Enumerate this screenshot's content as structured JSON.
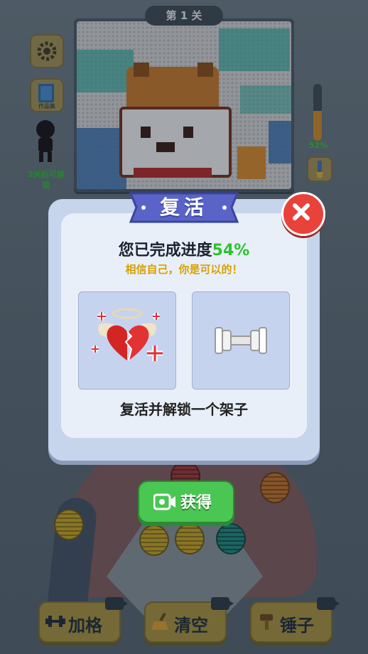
{
  "level": {
    "label": "第 1 关"
  },
  "left_panel": {
    "settings": {
      "icon": "gear-icon"
    },
    "gallery": {
      "label": "作品集",
      "icon": "book-icon"
    },
    "character": {
      "unlock_text": "2关后可解锁"
    }
  },
  "right_panel": {
    "progress": {
      "value": 0.52,
      "label": "52%"
    },
    "tool": {
      "icon": "brush-icon"
    }
  },
  "revive_dialog": {
    "title": "复活",
    "progress_prefix": "您已完成进度",
    "progress_value": "54%",
    "encourage": "相信自己，你是可以的！",
    "left_card_icon": "broken-heart-icon",
    "right_card_icon": "shelf-icon",
    "description": "复活并解锁一个架子",
    "action_button": {
      "label": "获得",
      "icon": "video-camera-icon"
    },
    "close": {
      "icon": "close-icon"
    }
  },
  "bottom_toolbar": [
    {
      "label": "加格",
      "icon": "dumbbell-icon"
    },
    {
      "label": "清空",
      "icon": "broom-icon"
    },
    {
      "label": "锤子",
      "icon": "hammer-icon"
    }
  ],
  "colors": {
    "accent_green": "#2cc42c",
    "encourage_yellow": "#d8a000",
    "close_red": "#e8423a",
    "ribbon_blue": "#5a63c8",
    "button_green": "#4ac653"
  }
}
